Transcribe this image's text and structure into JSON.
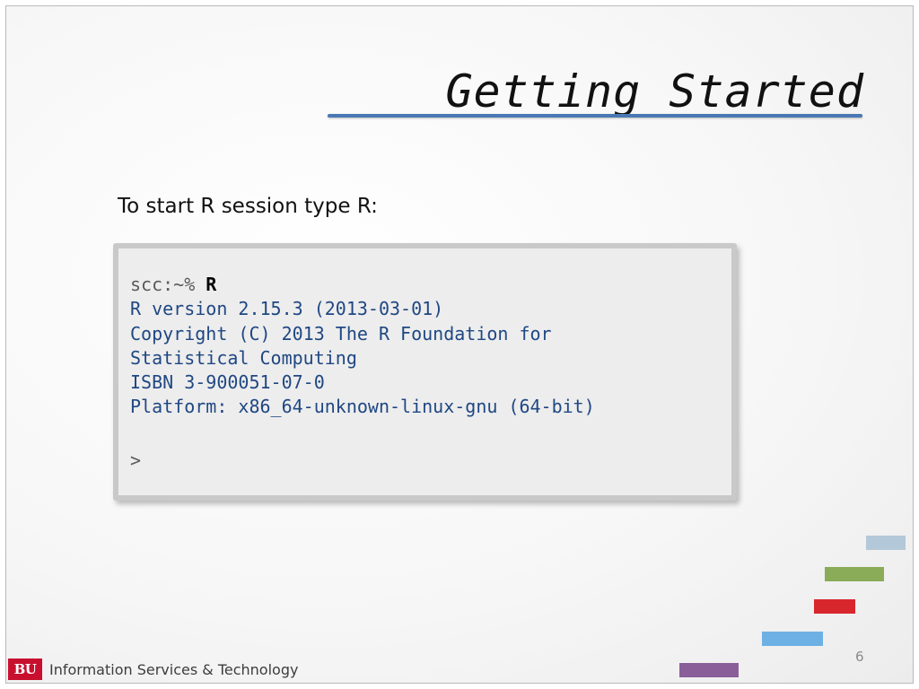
{
  "slide": {
    "title": "Getting Started",
    "intro": "To start R session type R:",
    "page_number": "6"
  },
  "terminal": {
    "prompt": "scc:~% ",
    "command": "R",
    "output": [
      "R version 2.15.3 (2013-03-01)",
      "Copyright (C) 2013 The R Foundation for",
      "Statistical Computing",
      "ISBN 3-900051-07-0",
      "Platform: x86_64-unknown-linux-gnu (64-bit)"
    ],
    "r_prompt": ">"
  },
  "footer": {
    "logo_text": "BU",
    "organization": "Information Services & Technology"
  },
  "colors": {
    "title_rule": "#4a78b4",
    "terminal_text": "#1f4783",
    "bu_red": "#c8102e",
    "deco_bars": [
      "#b3c8d8",
      "#8aab57",
      "#d8262d",
      "#6db0e3",
      "#8a5e99"
    ]
  }
}
